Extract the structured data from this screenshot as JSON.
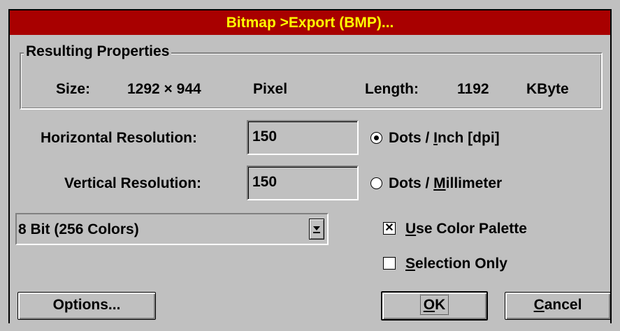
{
  "window": {
    "title": "Bitmap >Export (BMP)..."
  },
  "properties": {
    "legend": "Resulting Properties",
    "size_label": "Size:",
    "size_value": "1292 × 944",
    "size_unit": "Pixel",
    "length_label": "Length:",
    "length_value": "1192",
    "length_unit": "KByte"
  },
  "resolution": {
    "horizontal_label": "Horizontal Resolution:",
    "horizontal_value": "150",
    "vertical_label": "Vertical Resolution:",
    "vertical_value": "150"
  },
  "units": {
    "dpi": {
      "pre": "Dots / ",
      "key": "I",
      "post": "nch [dpi]",
      "selected": true
    },
    "dpmm": {
      "pre": "Dots / ",
      "key": "M",
      "post": "illimeter",
      "selected": false
    }
  },
  "color_depth": {
    "selected": "8 Bit (256 Colors)"
  },
  "options": {
    "use_palette": {
      "key": "U",
      "post": "se Color Palette",
      "checked": true
    },
    "selection_only": {
      "key": "S",
      "post": "election Only",
      "checked": false
    }
  },
  "buttons": {
    "options": "Options...",
    "ok": {
      "key": "O",
      "post": "K"
    },
    "cancel": {
      "key": "C",
      "post": "ancel"
    }
  }
}
